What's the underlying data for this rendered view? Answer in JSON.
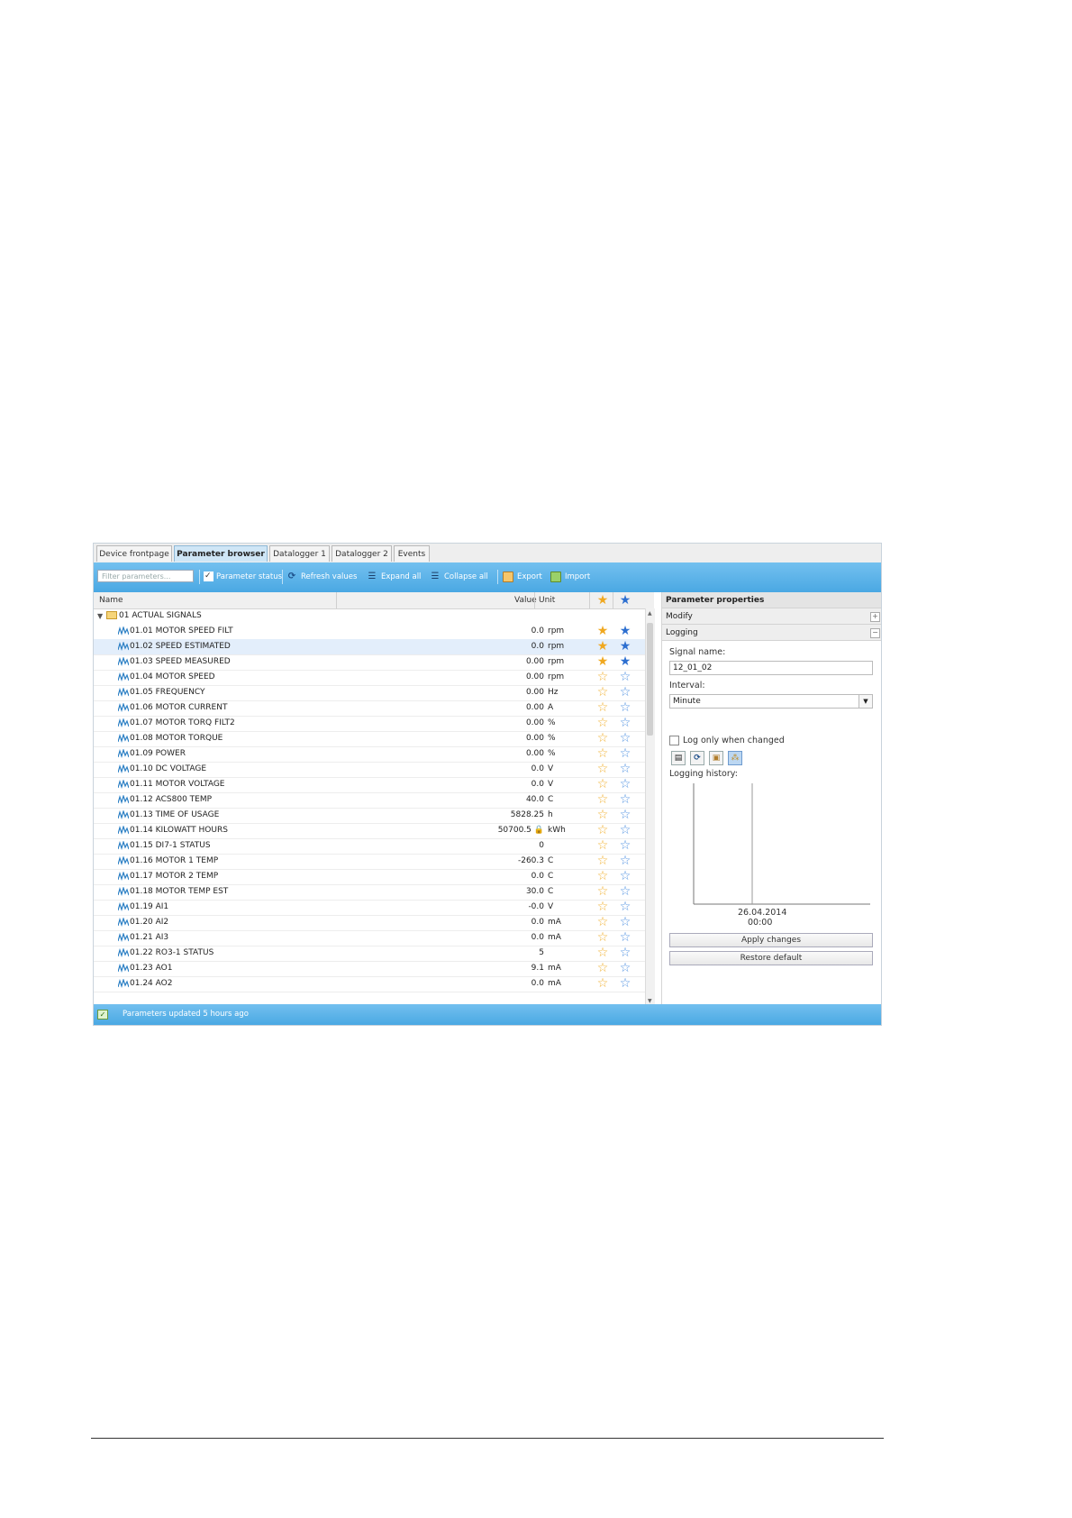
{
  "tabs": [
    {
      "label": "Device frontpage",
      "active": false
    },
    {
      "label": "Parameter browser",
      "active": true
    },
    {
      "label": "Datalogger 1",
      "active": false
    },
    {
      "label": "Datalogger 2",
      "active": false
    },
    {
      "label": "Events",
      "active": false
    }
  ],
  "toolbar": {
    "filter_placeholder": "Filter parameters...",
    "parameter_status_label": "Parameter status",
    "parameter_status_checked": true,
    "refresh_label": "Refresh values",
    "expand_label": "Expand all",
    "collapse_label": "Collapse all",
    "export_label": "Export",
    "import_label": "Import"
  },
  "list": {
    "columns": {
      "name": "Name",
      "value": "Value",
      "unit": "Unit"
    },
    "group": "01 ACTUAL SIGNALS",
    "selected_index": 1,
    "rows": [
      {
        "name": "01.01 MOTOR SPEED FILT",
        "value": "0.0",
        "unit": "rpm",
        "fav": true,
        "watch": true
      },
      {
        "name": "01.02 SPEED ESTIMATED",
        "value": "0.0",
        "unit": "rpm",
        "fav": true,
        "watch": true
      },
      {
        "name": "01.03 SPEED MEASURED",
        "value": "0.00",
        "unit": "rpm",
        "fav": true,
        "watch": true
      },
      {
        "name": "01.04 MOTOR SPEED",
        "value": "0.00",
        "unit": "rpm",
        "fav": false,
        "watch": false
      },
      {
        "name": "01.05 FREQUENCY",
        "value": "0.00",
        "unit": "Hz",
        "fav": false,
        "watch": false
      },
      {
        "name": "01.06 MOTOR CURRENT",
        "value": "0.00",
        "unit": "A",
        "fav": false,
        "watch": false
      },
      {
        "name": "01.07 MOTOR TORQ FILT2",
        "value": "0.00",
        "unit": "%",
        "fav": false,
        "watch": false
      },
      {
        "name": "01.08 MOTOR TORQUE",
        "value": "0.00",
        "unit": "%",
        "fav": false,
        "watch": false
      },
      {
        "name": "01.09 POWER",
        "value": "0.00",
        "unit": "%",
        "fav": false,
        "watch": false
      },
      {
        "name": "01.10 DC VOLTAGE",
        "value": "0.0",
        "unit": "V",
        "fav": false,
        "watch": false
      },
      {
        "name": "01.11 MOTOR VOLTAGE",
        "value": "0.0",
        "unit": "V",
        "fav": false,
        "watch": false
      },
      {
        "name": "01.12 ACS800 TEMP",
        "value": "40.0",
        "unit": "C",
        "fav": false,
        "watch": false
      },
      {
        "name": "01.13 TIME OF USAGE",
        "value": "5828.25",
        "unit": "h",
        "fav": false,
        "watch": false
      },
      {
        "name": "01.14 KILOWATT HOURS",
        "value": "50700.5",
        "unit": "kWh",
        "fav": false,
        "watch": false,
        "locked": true
      },
      {
        "name": "01.15 DI7-1 STATUS",
        "value": "0",
        "unit": "",
        "fav": false,
        "watch": false
      },
      {
        "name": "01.16 MOTOR 1 TEMP",
        "value": "-260.3",
        "unit": "C",
        "fav": false,
        "watch": false
      },
      {
        "name": "01.17 MOTOR 2 TEMP",
        "value": "0.0",
        "unit": "C",
        "fav": false,
        "watch": false
      },
      {
        "name": "01.18 MOTOR TEMP EST",
        "value": "30.0",
        "unit": "C",
        "fav": false,
        "watch": false
      },
      {
        "name": "01.19 AI1",
        "value": "-0.0",
        "unit": "V",
        "fav": false,
        "watch": false
      },
      {
        "name": "01.20 AI2",
        "value": "0.0",
        "unit": "mA",
        "fav": false,
        "watch": false
      },
      {
        "name": "01.21 AI3",
        "value": "0.0",
        "unit": "mA",
        "fav": false,
        "watch": false
      },
      {
        "name": "01.22 RO3-1 STATUS",
        "value": "5",
        "unit": "",
        "fav": false,
        "watch": false
      },
      {
        "name": "01.23 AO1",
        "value": "9.1",
        "unit": "mA",
        "fav": false,
        "watch": false
      },
      {
        "name": "01.24 AO2",
        "value": "0.0",
        "unit": "mA",
        "fav": false,
        "watch": false
      }
    ]
  },
  "props": {
    "title": "Parameter properties",
    "modify_label": "Modify",
    "logging_label": "Logging",
    "signal_name_label": "Signal name:",
    "signal_name_value": "12_01_02",
    "interval_label": "Interval:",
    "interval_value": "Minute",
    "log_only_changed_label": "Log only when changed",
    "log_only_changed_checked": false,
    "history_label": "Logging history:",
    "history_date": "26.04.2014",
    "history_time": "00:00",
    "apply_label": "Apply changes",
    "restore_label": "Restore default"
  },
  "status": {
    "text": "Parameters updated 5 hours ago"
  },
  "colors": {
    "toolbar": "#4aa8e3",
    "selected_row": "#e3eefb",
    "star_favorite": "#f0a820",
    "star_watch": "#2d6fd0"
  }
}
